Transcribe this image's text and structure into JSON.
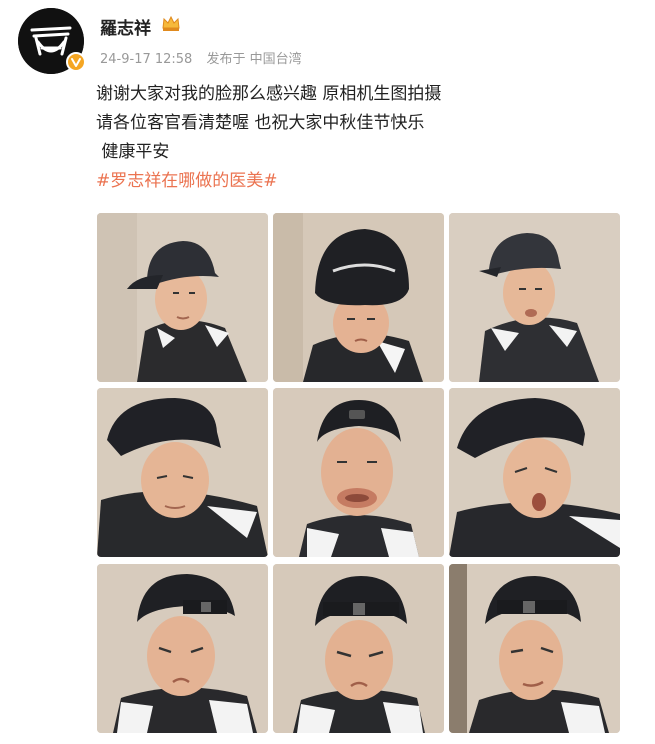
{
  "post": {
    "username": "羅志祥",
    "timestamp": "24-9-17 12:58",
    "source": "发布于 中国台湾",
    "text_lines": [
      "谢谢大家对我的脸那么感兴趣 原相机生图拍摄",
      "请各位客官看清楚喔 也祝大家中秋佳节快乐",
      " 健康平安"
    ],
    "hashtag": "#罗志祥在哪做的医美#"
  },
  "colors": {
    "hashtag": "#eb7350",
    "meta": "#999999",
    "verified_badge": "#f5a623"
  },
  "icons": {
    "avatar": "avatar",
    "verified": "verified-badge-icon",
    "crown": "crown-icon"
  },
  "photos": [
    {
      "pose": "cap-forward-side-look"
    },
    {
      "pose": "cap-forward-low-angle"
    },
    {
      "pose": "cap-forward-pout"
    },
    {
      "pose": "cap-raised-lean"
    },
    {
      "pose": "cap-backward-puffed-cheeks"
    },
    {
      "pose": "cap-raised-surprised"
    },
    {
      "pose": "cap-backward-frown"
    },
    {
      "pose": "cap-backward-scowl"
    },
    {
      "pose": "cap-backward-smirk"
    }
  ]
}
